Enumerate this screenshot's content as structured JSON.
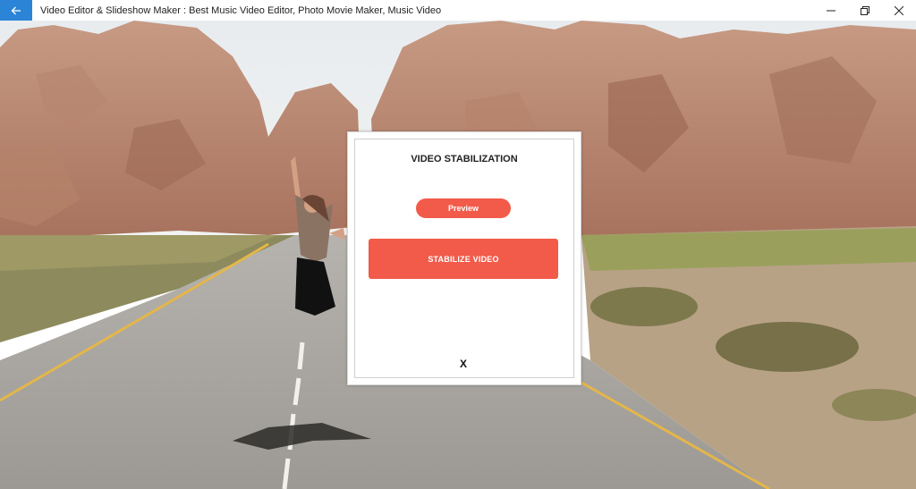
{
  "window": {
    "title": "Video Editor & Slideshow Maker : Best Music Video Editor, Photo Movie Maker, Music Video",
    "controls": [
      "minimize",
      "maximize",
      "close"
    ]
  },
  "titlebar": {
    "back_icon": "arrow-left-icon",
    "accent_color": "#2b84d6"
  },
  "dialog": {
    "title": "VIDEO STABILIZATION",
    "preview_label": "Preview",
    "stabilize_label": "STABILIZE VIDEO",
    "close_label": "X",
    "button_color": "#f25a4a"
  }
}
